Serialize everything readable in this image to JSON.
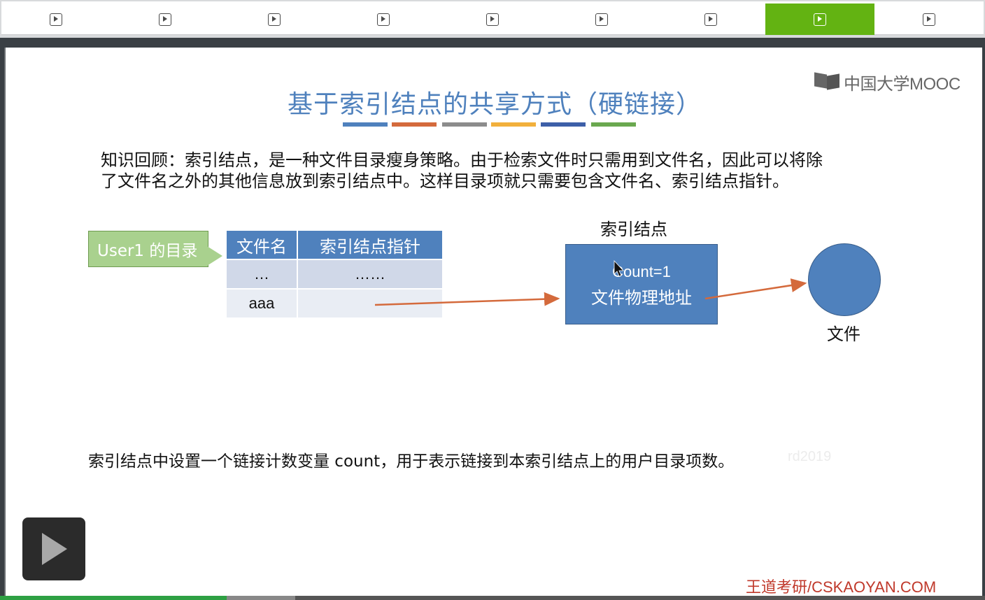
{
  "nav": {
    "items": [
      {
        "name": "chapter-1"
      },
      {
        "name": "chapter-2"
      },
      {
        "name": "chapter-3"
      },
      {
        "name": "chapter-4"
      },
      {
        "name": "chapter-5"
      },
      {
        "name": "chapter-6"
      },
      {
        "name": "chapter-7"
      },
      {
        "name": "chapter-8",
        "active": true
      },
      {
        "name": "chapter-9"
      }
    ],
    "icon": "play-square-icon",
    "active_color": "#63b312"
  },
  "slide": {
    "logo": "中国大学MOOC",
    "title": "基于索引结点的共享方式（硬链接）",
    "title_color": "#4f81bd",
    "color_bars": [
      "#4f81bd",
      "#d46a3c",
      "#8c8c8c",
      "#f2b03c",
      "#3d5fa8",
      "#6aa84f"
    ],
    "paragraph_line1": "知识回顾：索引结点，是一种文件目录瘦身策略。由于检索文件时只需用到文件名，因此可以将除",
    "paragraph_line2": "了文件名之外的其他信息放到索引结点中。这样目录项就只需要包含文件名、索引结点指针。",
    "directory": {
      "label": "User1 的目录",
      "headers": [
        "文件名",
        "索引结点指针"
      ],
      "rows": [
        [
          "…",
          "……"
        ],
        [
          "aaa",
          ""
        ]
      ]
    },
    "inode": {
      "label": "索引结点",
      "count": "Count=1",
      "address": "文件物理地址"
    },
    "file_label": "文件",
    "note": "索引结点中设置一个链接计数变量 count，用于表示链接到本索引结点上的用户目录项数。",
    "watermark": "rd2019",
    "footer": "王道考研/CSKAOYAN.COM"
  },
  "player": {
    "play_icon": "play-icon",
    "progress_percent": 23
  }
}
